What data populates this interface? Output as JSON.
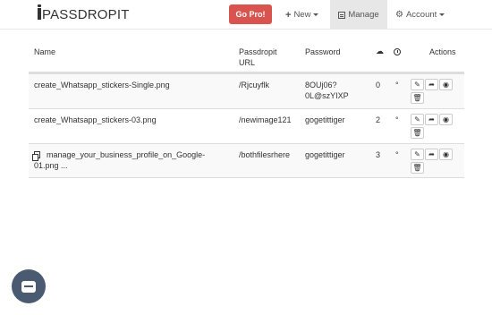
{
  "navbar": {
    "brand": "PASSDROPIT",
    "gopro_label": "Go Pro!",
    "new_label": "New",
    "manage_label": "Manage",
    "account_label": "Account"
  },
  "table": {
    "headers": {
      "name": "Name",
      "url_line1": "Passdropit",
      "url_line2": "URL",
      "password": "Password",
      "actions": "Actions"
    },
    "rows": [
      {
        "name": "create_Whatsapp_stickers-Single.png",
        "url": "/Rjcuyflk",
        "password_line1": "8OUj06?",
        "password_line2": "0L@szYIXP",
        "downloads": "0",
        "expiry": "°"
      },
      {
        "name": "create_Whatsapp_stickers-03.png",
        "url": "/newimage121",
        "password_line1": "gogetittiger",
        "password_line2": "",
        "downloads": "2",
        "expiry": "°"
      },
      {
        "name_line1": "manage_your_business_profile_on_Google-",
        "name_line2": "01.png ...",
        "url": "/bothfilesrhere",
        "password_line1": "gogetittiger",
        "password_line2": "",
        "downloads": "3",
        "expiry": "°"
      }
    ]
  },
  "icons": {
    "brand": "passdropit-logo-icon",
    "new": "plus-icon",
    "manage": "list-icon",
    "account": "gear-icon",
    "downloads": "cloud-download-icon",
    "expiry": "clock-icon",
    "edit": "pencil-icon",
    "share": "share-icon",
    "view": "eye-icon",
    "delete": "trash-icon",
    "multi": "copy-icon",
    "chat": "chat-icon"
  },
  "colors": {
    "gopro": "#d9534f",
    "active_nav": "#e7e7e7",
    "chat": "#4a5a70"
  }
}
